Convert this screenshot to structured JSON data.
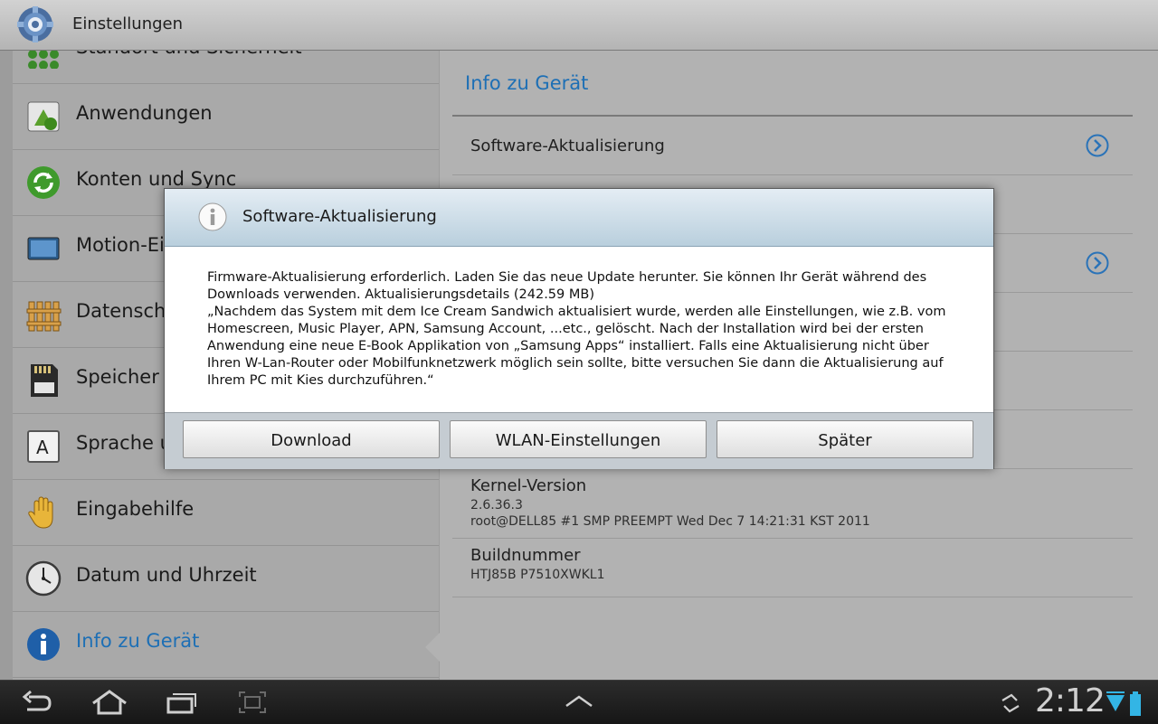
{
  "app": {
    "title": "Einstellungen"
  },
  "settings_list": {
    "items": [
      {
        "label": "Standort und Sicherheit",
        "icon": "location-security-icon"
      },
      {
        "label": "Anwendungen",
        "icon": "applications-icon"
      },
      {
        "label": "Konten und Sync",
        "icon": "sync-icon"
      },
      {
        "label": "Motion-Ei",
        "icon": "motion-icon"
      },
      {
        "label": "Datenschu",
        "icon": "privacy-fence-icon"
      },
      {
        "label": "Speicher",
        "icon": "sd-card-icon"
      },
      {
        "label": "Sprache u",
        "icon": "language-icon"
      },
      {
        "label": "Eingabehilfe",
        "icon": "hand-icon"
      },
      {
        "label": "Datum und Uhrzeit",
        "icon": "clock-icon"
      },
      {
        "label": "Info zu Gerät",
        "icon": "info-icon",
        "selected": true
      }
    ]
  },
  "detail": {
    "header": "Info zu Gerät",
    "software_update": "Software-Aktualisierung",
    "kernel": {
      "title": "Kernel-Version",
      "line1": "2.6.36.3",
      "line2": "root@DELL85 #1 SMP PREEMPT Wed Dec 7 14:21:31 KST 2011"
    },
    "build": {
      "title": "Buildnummer",
      "value": "HTJ85B P7510XWKL1"
    }
  },
  "dialog": {
    "title": "Software-Aktualisierung",
    "body_line1": "Firmware-Aktualisierung erforderlich. Laden Sie das neue Update herunter. Sie können Ihr Gerät während des Downloads verwenden. Aktualisierungsdetails (242.59 MB)",
    "body_line2": "„Nachdem das System mit dem Ice Cream Sandwich aktualisiert wurde, werden alle Einstellungen, wie z.B. vom Homescreen, Music Player, APN, Samsung Account, ...etc., gelöscht. Nach der Installation wird bei der ersten Anwendung eine neue E-Book Applikation von „Samsung Apps“ installiert. Falls eine Aktualisierung nicht über Ihren W-Lan-Router oder Mobilfunknetzwerk möglich sein sollte, bitte versuchen Sie dann die Aktualisierung auf Ihrem PC mit Kies durchzuführen.“",
    "buttons": {
      "download": "Download",
      "wlan": "WLAN-Einstellungen",
      "later": "Später"
    }
  },
  "system_bar": {
    "time": "2:12",
    "accent": "#33b5e5"
  }
}
